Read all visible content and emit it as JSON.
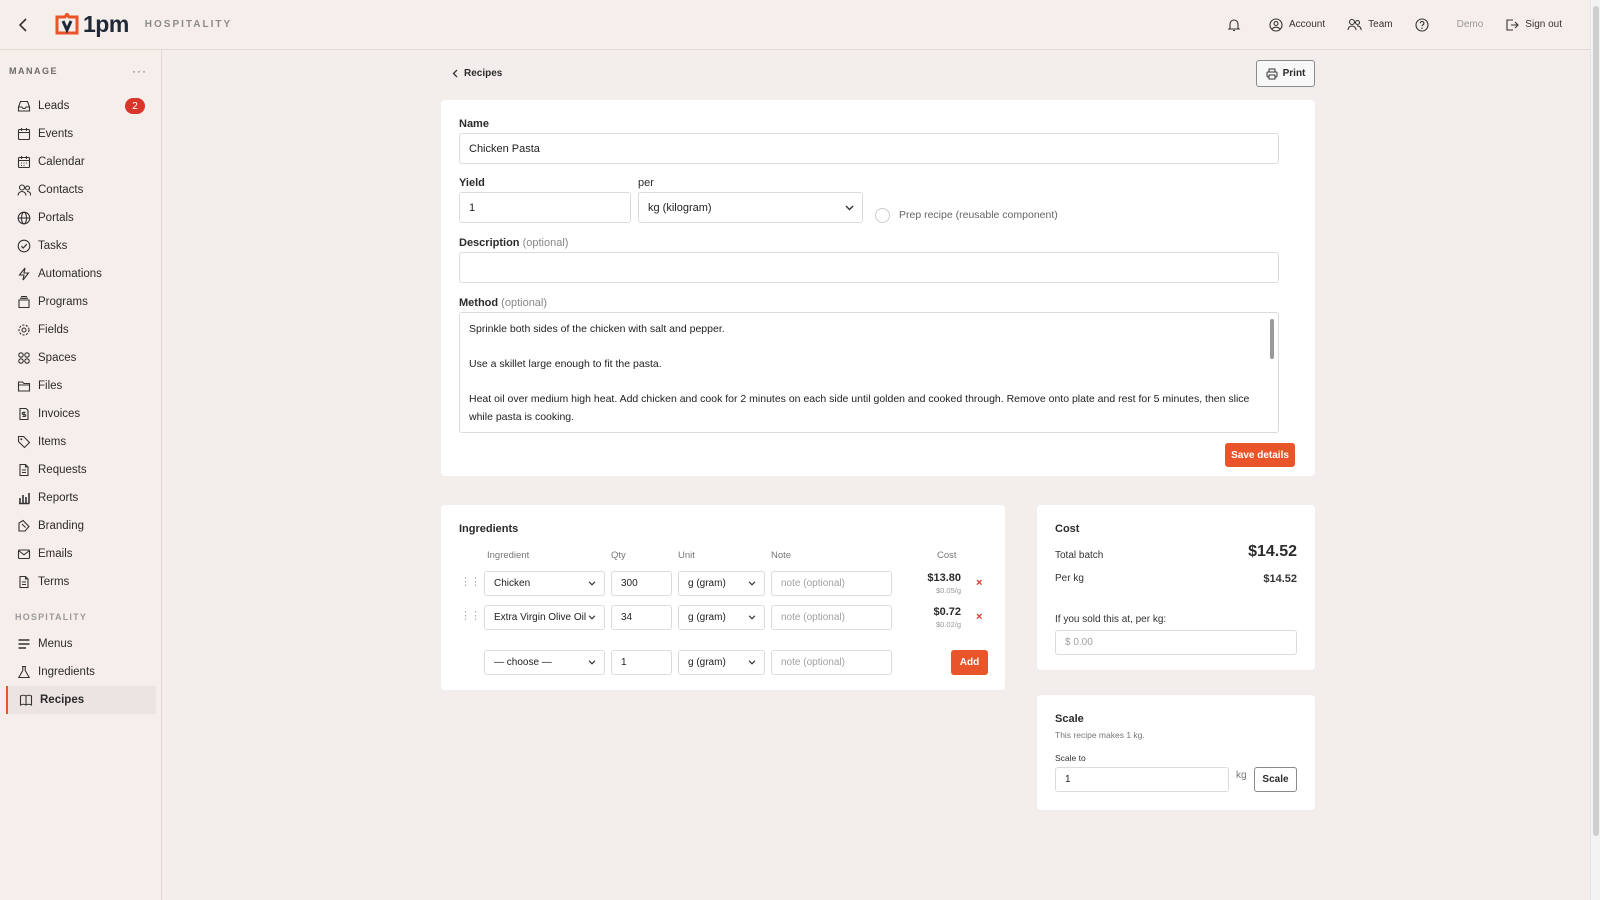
{
  "topbar": {
    "logo_text": "1pm",
    "brand": "HOSPITALITY",
    "nav": {
      "notifications_icon": "bell-icon",
      "account": "Account",
      "team": "Team",
      "help_icon": "help-icon",
      "demo": "Demo",
      "signout": "Sign out"
    }
  },
  "sidebar": {
    "manage_heading": "MANAGE",
    "more": "···",
    "items": [
      {
        "label": "Leads",
        "icon": "inbox-icon",
        "badge": "2"
      },
      {
        "label": "Events",
        "icon": "calendar-icon"
      },
      {
        "label": "Calendar",
        "icon": "calendar-grid-icon"
      },
      {
        "label": "Contacts",
        "icon": "users-icon"
      },
      {
        "label": "Portals",
        "icon": "globe-icon"
      },
      {
        "label": "Tasks",
        "icon": "check-circle-icon"
      },
      {
        "label": "Automations",
        "icon": "lightning-icon"
      },
      {
        "label": "Programs",
        "icon": "layers-icon"
      },
      {
        "label": "Fields",
        "icon": "gear-icon"
      },
      {
        "label": "Spaces",
        "icon": "grid-icon"
      },
      {
        "label": "Files",
        "icon": "folder-icon"
      },
      {
        "label": "Invoices",
        "icon": "invoice-icon"
      },
      {
        "label": "Items",
        "icon": "tag-icon"
      },
      {
        "label": "Requests",
        "icon": "document-icon"
      },
      {
        "label": "Reports",
        "icon": "bar-chart-icon"
      },
      {
        "label": "Branding",
        "icon": "brush-icon"
      },
      {
        "label": "Emails",
        "icon": "mail-icon"
      },
      {
        "label": "Terms",
        "icon": "document-icon"
      }
    ],
    "hospitality_heading": "HOSPITALITY",
    "hospitality_items": [
      {
        "label": "Menus",
        "icon": "menu-lines-icon"
      },
      {
        "label": "Ingredients",
        "icon": "flask-icon"
      },
      {
        "label": "Recipes",
        "icon": "book-icon",
        "active": true
      }
    ]
  },
  "page": {
    "breadcrumb": "Recipes",
    "print_label": "Print"
  },
  "details": {
    "name_label": "Name",
    "name_value": "Chicken Pasta",
    "yield_label": "Yield",
    "yield_value": "1",
    "per_label": "per",
    "per_value": "kg (kilogram)",
    "prep_label": "Prep recipe (reusable component)",
    "description_label": "Description",
    "optional": "(optional)",
    "description_value": "",
    "method_label": "Method",
    "method_lines": [
      "Sprinkle both sides of the chicken with salt and pepper.",
      "Use a skillet large enough to fit the pasta.",
      "Heat oil over medium high heat. Add chicken and cook for 2 minutes on each side until golden and cooked through. Remove onto plate and rest for 5 minutes, then slice while pasta is cooking."
    ],
    "save_label": "Save details"
  },
  "ingredients": {
    "title": "Ingredients",
    "headers": {
      "ingredient": "Ingredient",
      "qty": "Qty",
      "unit": "Unit",
      "note": "Note",
      "cost": "Cost"
    },
    "rows": [
      {
        "ingredient": "Chicken",
        "qty": "300",
        "unit": "g (gram)",
        "note_placeholder": "note (optional)",
        "cost": "$13.80",
        "unit_cost": "$0.05/g",
        "remove": "×"
      },
      {
        "ingredient": "Extra Virgin Olive Oil",
        "qty": "34",
        "unit": "g (gram)",
        "note_placeholder": "note (optional)",
        "cost": "$0.72",
        "unit_cost": "$0.02/g",
        "remove": "×"
      }
    ],
    "new_row": {
      "ingredient": "— choose —",
      "qty": "1",
      "unit": "g (gram)",
      "note_placeholder": "note (optional)",
      "add_label": "Add"
    }
  },
  "cost": {
    "title": "Cost",
    "total_batch_label": "Total batch",
    "total_batch_value": "$14.52",
    "per_kg_label": "Per kg",
    "per_kg_value": "$14.52",
    "sold_label": "If you sold this at, per kg:",
    "sold_placeholder": "$ 0.00"
  },
  "scale": {
    "title": "Scale",
    "note": "This recipe makes 1 kg.",
    "scale_to_label": "Scale to",
    "scale_value": "1",
    "unit": "kg",
    "button": "Scale"
  },
  "colors": {
    "accent": "#e9542b",
    "badge": "#d9362b",
    "background": "#f3eeec"
  }
}
